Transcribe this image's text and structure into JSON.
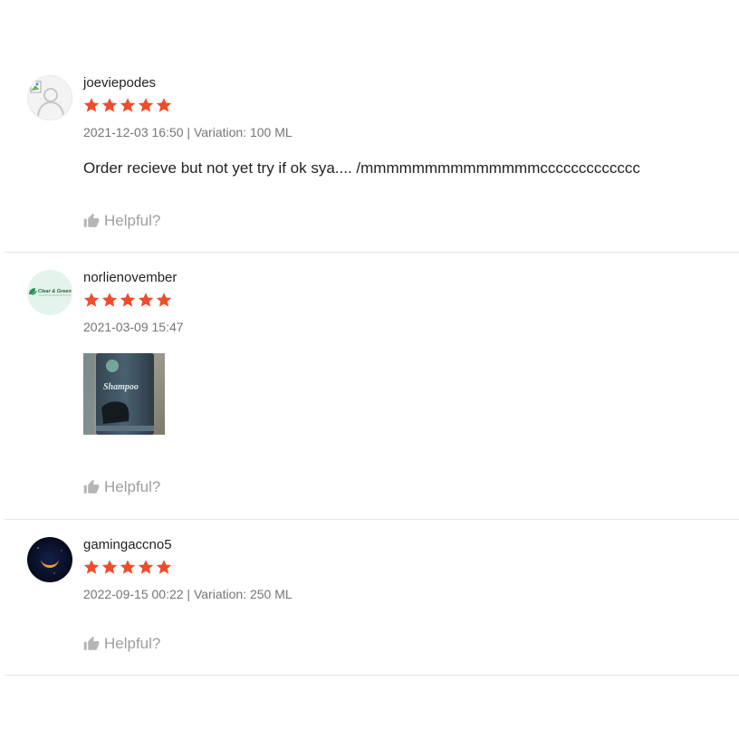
{
  "reviews": [
    {
      "username": "joeviepodes",
      "rating": 5,
      "date": "2021-12-03 16:50",
      "separator": " | ",
      "variation": "Variation: 100 ML",
      "comment": "Order recieve but not yet try if ok sya.... /mmmmmmmmmmmmmmccccccccccccc",
      "helpful_label": "Helpful?",
      "avatar_icon": "default-user-avatar"
    },
    {
      "username": "norlienovember",
      "rating": 5,
      "date": "2021-03-09 15:47",
      "helpful_label": "Helpful?",
      "avatar_text": "Clear & Green",
      "photo_text": "Shampoo"
    },
    {
      "username": "gamingaccno5",
      "rating": 5,
      "date": "2022-09-15 00:22",
      "separator": " | ",
      "variation": "Variation: 250 ML",
      "helpful_label": "Helpful?",
      "avatar_icon": "crescent-moon-avatar"
    }
  ],
  "colors": {
    "star": "#ee4d2d",
    "text": "#222222",
    "meta": "#757575",
    "helpful": "#9e9e9e",
    "divider": "#e5e5e5"
  }
}
